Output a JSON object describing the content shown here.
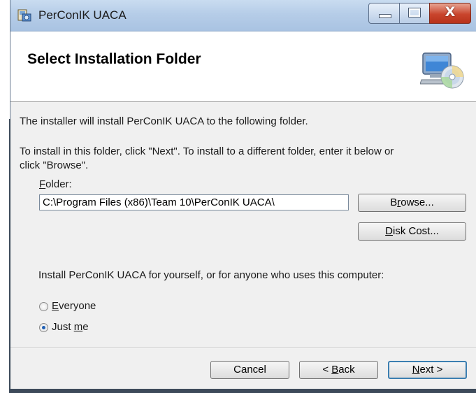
{
  "window": {
    "title": "PerConIK UACA",
    "close_glyph": "X",
    "minimize_icon": "minimize-icon",
    "maximize_icon": "maximize-icon"
  },
  "header": {
    "title": "Select Installation Folder",
    "icon": "computer-cd-icon"
  },
  "body": {
    "intro": "The installer will install PerConIK UACA to the following folder.",
    "instructions_line1": "To install in this folder, click \"Next\". To install to a different folder, enter it below or",
    "instructions_line2": "click \"Browse\".",
    "folder_label_accel": "F",
    "folder_label_rest": "older:",
    "folder_value": "C:\\Program Files (x86)\\Team 10\\PerConIK UACA\\",
    "browse_pre": "B",
    "browse_accel": "r",
    "browse_post": "owse...",
    "diskcost_accel": "D",
    "diskcost_post": "isk Cost...",
    "install_for": "Install PerConIK UACA for yourself, or for anyone who uses this computer:",
    "everyone_accel": "E",
    "everyone_post": "veryone",
    "justme_pre": "Just ",
    "justme_accel": "m",
    "justme_post": "e",
    "selected_option": "Just me"
  },
  "footer": {
    "cancel": "Cancel",
    "back_pre": "< ",
    "back_accel": "B",
    "back_post": "ack",
    "next_accel": "N",
    "next_post": "ext >"
  },
  "colors": {
    "titlebar": "#b6cde8",
    "close": "#c9452d",
    "dialog_bg": "#f0f0f0",
    "default_button_border": "#3c7fb1"
  }
}
